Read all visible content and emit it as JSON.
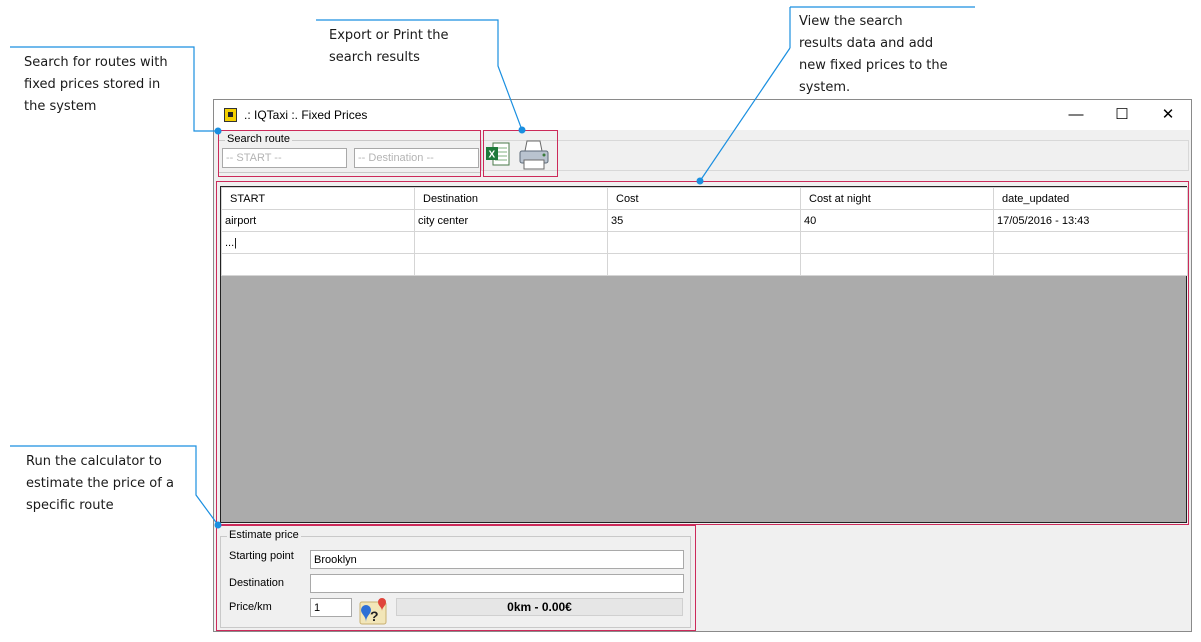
{
  "callouts": {
    "search": [
      "Search for routes with",
      "fixed prices stored in",
      "the system"
    ],
    "export": [
      "Export or Print the",
      "search results"
    ],
    "view": [
      "View the search",
      "results data and add",
      "new fixed prices to the",
      "system."
    ],
    "calc": [
      "Run the calculator to",
      "estimate the price of a",
      "specific route"
    ]
  },
  "window": {
    "title": ".: IQTaxi :. Fixed Prices",
    "minimize": "—",
    "maximize": "☐",
    "close": "✕"
  },
  "search": {
    "legend": "Search route",
    "start_placeholder": "-- START --",
    "destination_placeholder": "-- Destination --"
  },
  "grid": {
    "columns": [
      "START",
      "Destination",
      "Cost",
      "Cost at night",
      "date_updated"
    ],
    "rows": [
      [
        "airport",
        "city center",
        "35",
        "40",
        "17/05/2016 - 13:43"
      ],
      [
        "...|",
        "",
        "",
        "",
        ""
      ],
      [
        "",
        "",
        "",
        "",
        ""
      ]
    ]
  },
  "estimate": {
    "legend": "Estimate price",
    "starting_point_label": "Starting point",
    "starting_point_value": "Brooklyn",
    "destination_label": "Destination",
    "destination_value": "",
    "price_km_label": "Price/km",
    "price_km_value": "1",
    "result": "0km - 0.00€"
  },
  "colors": {
    "callout_line": "#1a8fe0",
    "highlight": "#cc2a5a",
    "grid_background": "#ababab"
  }
}
